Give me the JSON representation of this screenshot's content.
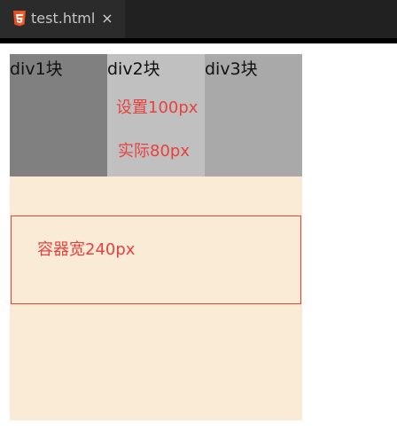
{
  "tab": {
    "title": "test.html",
    "icon": "html5-icon",
    "close": "×"
  },
  "blocks": [
    {
      "label": "div1块",
      "color": "#808080"
    },
    {
      "label": "div2块",
      "color": "#c0c0c0"
    },
    {
      "label": "div3块",
      "color": "#a9a9a9"
    }
  ],
  "notes": {
    "set_width": "设置100px",
    "actual_width": "实际80px"
  },
  "container": {
    "background": "#faebd7",
    "label": "容器宽240px"
  },
  "accent_color": "#e8413e"
}
